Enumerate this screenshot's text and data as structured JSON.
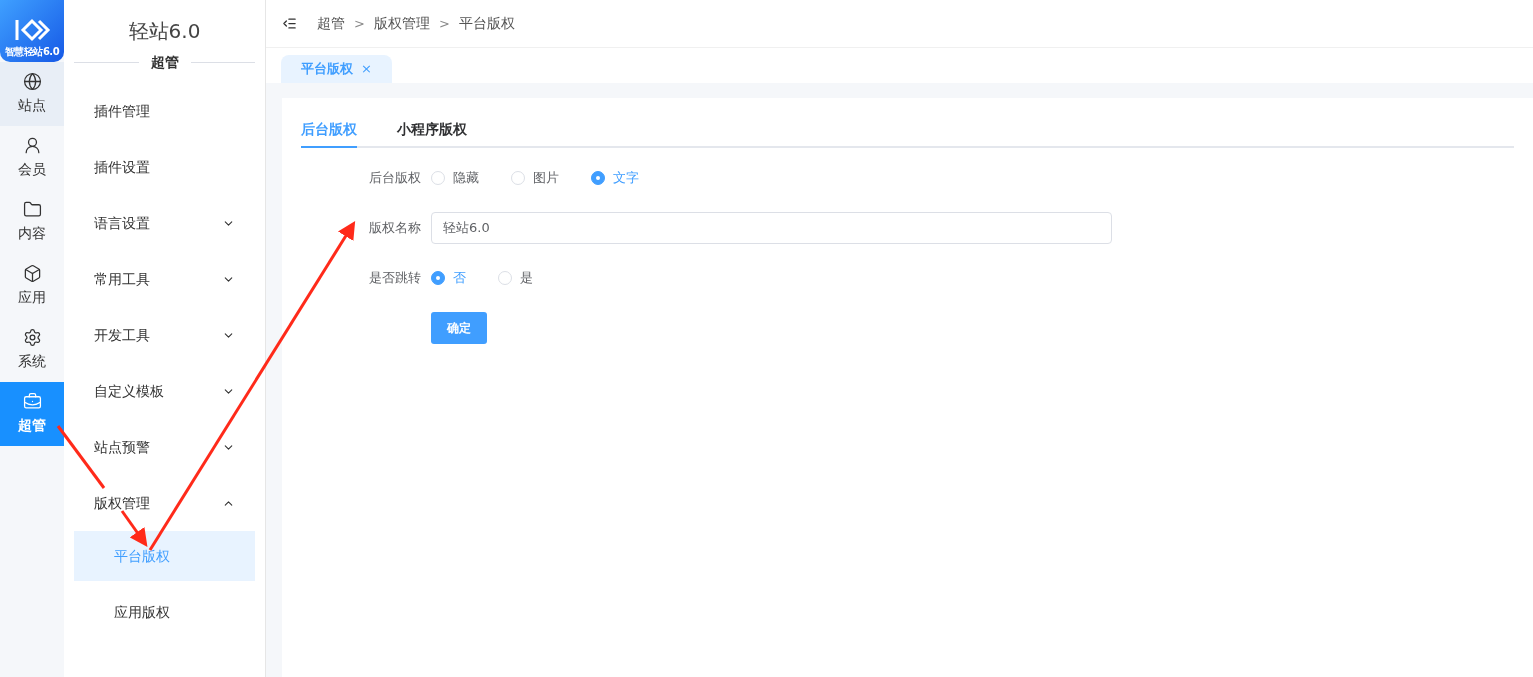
{
  "logo": {
    "caption": "智慧轻站6.0"
  },
  "rail": [
    {
      "label": "站点",
      "selected": false,
      "hovered": true
    },
    {
      "label": "会员",
      "selected": false,
      "hovered": false
    },
    {
      "label": "内容",
      "selected": false,
      "hovered": false
    },
    {
      "label": "应用",
      "selected": false,
      "hovered": false
    },
    {
      "label": "系统",
      "selected": false,
      "hovered": false
    },
    {
      "label": "超管",
      "selected": true,
      "hovered": false
    }
  ],
  "sidebar": {
    "title": "轻站6.0",
    "section": "超管",
    "items": [
      {
        "label": "插件管理",
        "kind": "leaf"
      },
      {
        "label": "插件设置",
        "kind": "leaf"
      },
      {
        "label": "语言设置",
        "kind": "group",
        "expanded": false
      },
      {
        "label": "常用工具",
        "kind": "group",
        "expanded": false
      },
      {
        "label": "开发工具",
        "kind": "group",
        "expanded": false
      },
      {
        "label": "自定义模板",
        "kind": "group",
        "expanded": false
      },
      {
        "label": "站点预警",
        "kind": "group",
        "expanded": false
      },
      {
        "label": "版权管理",
        "kind": "group",
        "expanded": true,
        "children": [
          {
            "label": "平台版权",
            "selected": true
          },
          {
            "label": "应用版权",
            "selected": false
          }
        ]
      }
    ]
  },
  "breadcrumb": [
    "超管",
    "版权管理",
    "平台版权"
  ],
  "breadcrumb_separator": ">",
  "page_tabs": [
    {
      "label": "平台版权",
      "selected": true,
      "close": "×"
    }
  ],
  "tabs": [
    {
      "label": "后台版权",
      "selected": true
    },
    {
      "label": "小程序版权",
      "selected": false
    }
  ],
  "form": [
    {
      "label": "后台版权",
      "kind": "radio",
      "options": [
        {
          "label": "隐藏",
          "selected": false
        },
        {
          "label": "图片",
          "selected": false
        },
        {
          "label": "文字",
          "selected": true
        }
      ]
    },
    {
      "label": "版权名称",
      "kind": "input",
      "value": "轻站6.0"
    },
    {
      "label": "是否跳转",
      "kind": "radio",
      "options": [
        {
          "label": "否",
          "selected": true
        },
        {
          "label": "是",
          "selected": false
        }
      ]
    }
  ],
  "submit": "确定"
}
